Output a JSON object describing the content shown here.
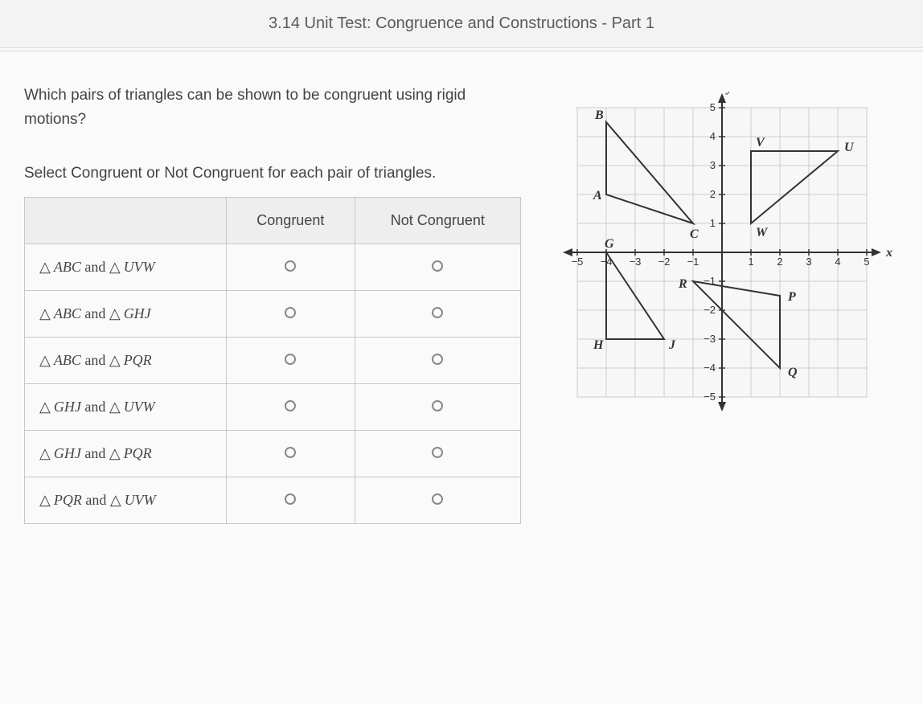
{
  "header": {
    "title": "3.14 Unit Test: Congruence and Constructions - Part 1"
  },
  "question": "Which pairs of triangles can be shown to be congruent using rigid motions?",
  "instruction": "Select Congruent or Not Congruent for each pair of triangles.",
  "table": {
    "col1": "Congruent",
    "col2": "Not Congruent",
    "rows": [
      {
        "t1": "ABC",
        "t2": "UVW"
      },
      {
        "t1": "ABC",
        "t2": "GHJ"
      },
      {
        "t1": "ABC",
        "t2": "PQR"
      },
      {
        "t1": "GHJ",
        "t2": "UVW"
      },
      {
        "t1": "GHJ",
        "t2": "PQR"
      },
      {
        "t1": "PQR",
        "t2": "UVW"
      }
    ]
  },
  "chart_data": {
    "type": "scatter",
    "title": "",
    "xlabel": "x",
    "ylabel": "y",
    "xlim": [
      -5,
      5
    ],
    "ylim": [
      -5,
      5
    ],
    "xticks": [
      -5,
      -4,
      -3,
      -2,
      -1,
      1,
      2,
      3,
      4,
      5
    ],
    "yticks": [
      -5,
      -4,
      -3,
      -2,
      -1,
      1,
      2,
      3,
      4,
      5
    ],
    "triangles": [
      {
        "name": "ABC",
        "vertices": {
          "A": [
            -4,
            2
          ],
          "B": [
            -4,
            4.5
          ],
          "C": [
            -1,
            1
          ]
        }
      },
      {
        "name": "UVW",
        "vertices": {
          "U": [
            4,
            3.5
          ],
          "V": [
            1,
            3.5
          ],
          "W": [
            1,
            1
          ]
        }
      },
      {
        "name": "GHJ",
        "vertices": {
          "G": [
            -4,
            0
          ],
          "H": [
            -4,
            -3
          ],
          "J": [
            -2,
            -3
          ]
        }
      },
      {
        "name": "PQR",
        "vertices": {
          "P": [
            2,
            -1.5
          ],
          "Q": [
            2,
            -4
          ],
          "R": [
            -1,
            -1
          ]
        }
      }
    ]
  }
}
